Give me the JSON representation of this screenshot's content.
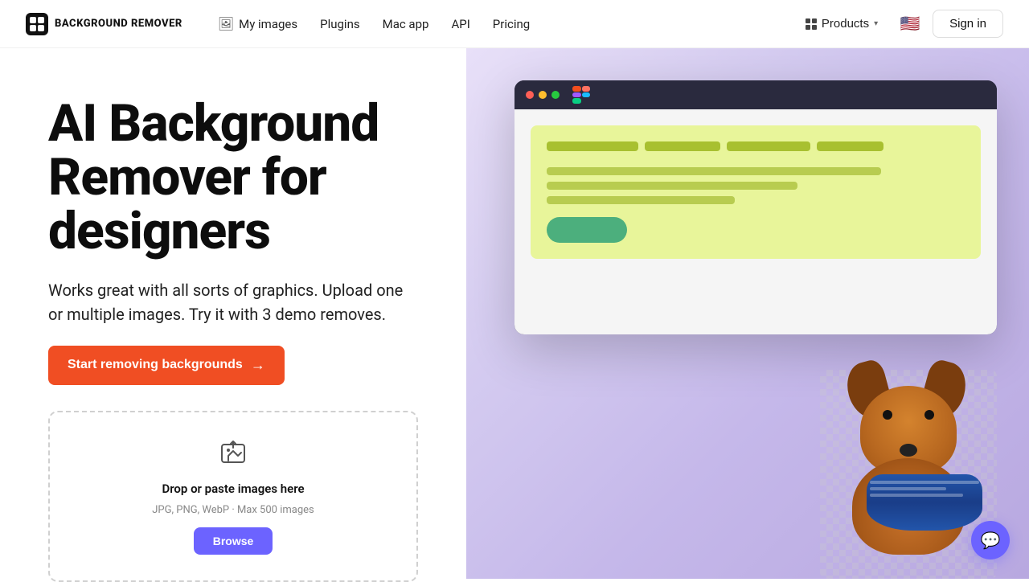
{
  "navbar": {
    "logo_text": "BACKGROUND REMOVER",
    "nav_items": [
      {
        "id": "my-images",
        "label": "My images",
        "has_icon": true
      },
      {
        "id": "plugins",
        "label": "Plugins"
      },
      {
        "id": "mac-app",
        "label": "Mac app"
      },
      {
        "id": "api",
        "label": "API"
      },
      {
        "id": "pricing",
        "label": "Pricing"
      }
    ],
    "products_label": "Products",
    "signin_label": "Sign in"
  },
  "hero": {
    "title": "AI Background Remover for designers",
    "subtitle": "Works great with all sorts of graphics. Upload one or multiple images. Try it with 3 demo removes.",
    "cta_label": "Start removing backgrounds"
  },
  "upload": {
    "title": "Drop or paste images here",
    "subtitle": "JPG, PNG, WebP · Max 500 images",
    "btn_label": "Browse"
  },
  "chat": {
    "icon": "💬"
  }
}
